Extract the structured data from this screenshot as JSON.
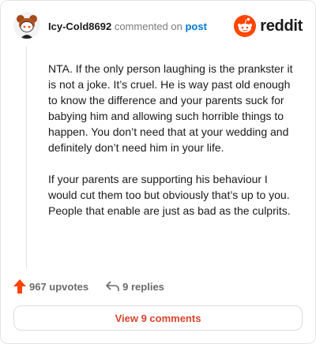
{
  "comment": {
    "username": "Icy-Cold8692",
    "action_text": "commented on",
    "target_text": "post",
    "paragraphs": [
      "NTA. If the only person laughing is the prankster it is not a joke. It’s cruel. He is way past old enough to know the difference and your parents suck for babying him and allowing such horrible things to happen. You don’t need that at your wedding and definitely don’t need him in your life.",
      "If your parents are supporting his behaviour I would cut them too but obviously that’s up to you. People that enable are just as bad as the culprits."
    ],
    "upvotes": "967 upvotes",
    "replies": "9 replies",
    "view_comments": "View 9 comments"
  },
  "brand": {
    "wordmark": "reddit",
    "logo_icon": "reddit-logo-icon",
    "accent": "#ff4500"
  },
  "icons": {
    "upvote": "upvote-arrow-icon",
    "reply": "reply-arrow-icon",
    "avatar": "snoo-avatar"
  }
}
